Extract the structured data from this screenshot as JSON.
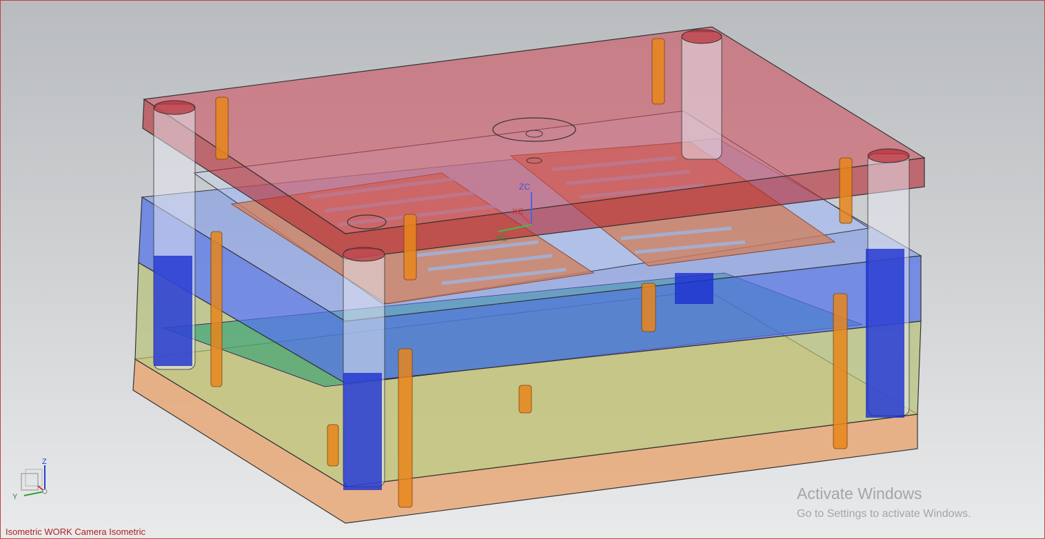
{
  "viewport": {
    "view_label": "Isometric WORK Camera Isometric",
    "wcs_labels": {
      "zc": "ZC",
      "xc": "XC",
      "yc": "YC"
    },
    "triad_labels": {
      "z": "Z",
      "y": "Y"
    },
    "watermark": {
      "title": "Activate Windows",
      "subtitle": "Go to Settings to activate Windows."
    },
    "colors": {
      "viewport_border": "#c83c3c",
      "clamp_plate_top": "#c0323c",
      "a_plate": "#5070e8",
      "b_plate": "#a8c060",
      "clamp_plate_bottom": "#e8a878",
      "guide_pins": "#2030c0",
      "return_pins": "#e88a20",
      "product": "#d08060"
    },
    "icons": {
      "model": "mold-assembly-model",
      "wcs": "wcs-axes-icon",
      "triad": "view-triad-icon"
    }
  }
}
